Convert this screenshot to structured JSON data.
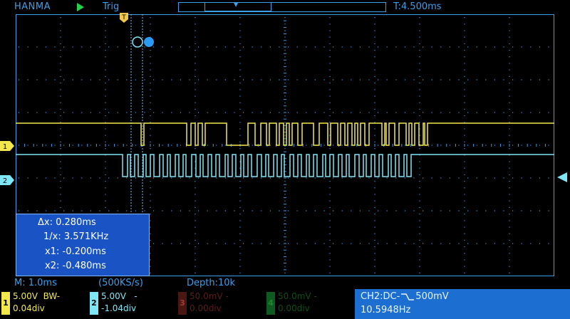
{
  "header": {
    "brand": "HANMA",
    "run_state": "play-icon",
    "trigger_status": "Trig",
    "trigger_delay": "T:4.500ms"
  },
  "cursor_readout": {
    "dx": "0.280ms",
    "inv_dx": "3.571KHz",
    "x1": "-0.200ms",
    "x2": "-0.480ms",
    "labels": {
      "dx": "Δx:",
      "inv": "1/x:",
      "x1": "x1:",
      "x2": "x2:"
    }
  },
  "status": {
    "timebase": "M: 1.0ms",
    "sample_rate": "(500KS/s)",
    "depth": "Depth:10k"
  },
  "channels": [
    {
      "num": "1",
      "volts": "5.00V",
      "bw": "BW-",
      "offset": "0.04div",
      "color": "#f2e84c",
      "enabled": true
    },
    {
      "num": "2",
      "volts": "5.00V",
      "bw": "-",
      "offset": "-1.04div",
      "color": "#7fe6f5",
      "enabled": true
    },
    {
      "num": "3",
      "volts": "50.0mV",
      "bw": "-",
      "offset": "0.00div",
      "color": "#a03a35",
      "enabled": false
    },
    {
      "num": "4",
      "volts": "50.0mV",
      "bw": "-",
      "offset": "0.00div",
      "color": "#1b8a33",
      "enabled": false
    }
  ],
  "trigger_info": {
    "source": "CH2:DC-",
    "level": "500mV",
    "frequency": "10.5948Hz"
  },
  "markers": {
    "trigger_marker": "T",
    "ch1_marker": "1",
    "ch2_marker": "2"
  },
  "colors": {
    "grid": "#3aa0ea",
    "ch1": "#f2e84c",
    "ch2": "#7fe6f5",
    "cursor": "#7fb6ff"
  }
}
